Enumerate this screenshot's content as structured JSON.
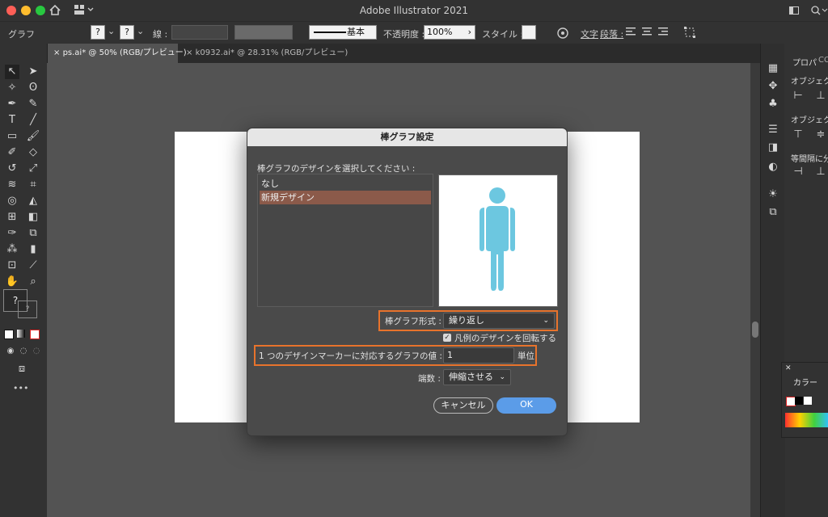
{
  "window": {
    "title": "Adobe Illustrator 2021"
  },
  "controlbar": {
    "object_type": "グラフ",
    "stroke_label": "線 :",
    "stroke_style": "基本",
    "opacity_label": "不透明度 :",
    "opacity_value": "100%",
    "style_label": "スタイル :",
    "text_label": "文字",
    "paragraph_label": "段落 :"
  },
  "tabs": [
    {
      "label": "ps.ai* @ 50% (RGB/プレビュー)",
      "active": true
    },
    {
      "label": "k0932.ai* @ 28.31% (RGB/プレビュー)",
      "active": false
    }
  ],
  "right_panel": {
    "tab_properties": "プロパ",
    "tab_cc": "CC",
    "section1": "オブジェク",
    "section2": "オブジェク",
    "section3": "等間隔に分"
  },
  "color_panel": {
    "title": "カラー"
  },
  "toolbar": {
    "unknown_fill": "?",
    "unknown_stroke": "?",
    "more": "•••"
  },
  "dialog": {
    "title": "棒グラフ設定",
    "prompt": "棒グラフのデザインを選択してください :",
    "designs": [
      "なし",
      "新規デザイン"
    ],
    "selected_design": "新規デザイン",
    "column_type_label": "棒グラフ形式 :",
    "column_type_value": "繰り返し",
    "rotate_legend_label": "凡例のデザインを回転する",
    "rotate_legend_checked": true,
    "each_design_label": "1 つのデザインマーカーに対応するグラフの値 :",
    "each_design_value": "1",
    "unit_label": "単位",
    "fraction_label": "端数 :",
    "fraction_value": "伸縮させる",
    "cancel_label": "キャンセル",
    "ok_label": "OK"
  },
  "colors": {
    "accent_highlight": "#e8732c",
    "selection": "#8b5a4a",
    "ok_button": "#5b9ce8",
    "figure": "#6cc7e0"
  }
}
